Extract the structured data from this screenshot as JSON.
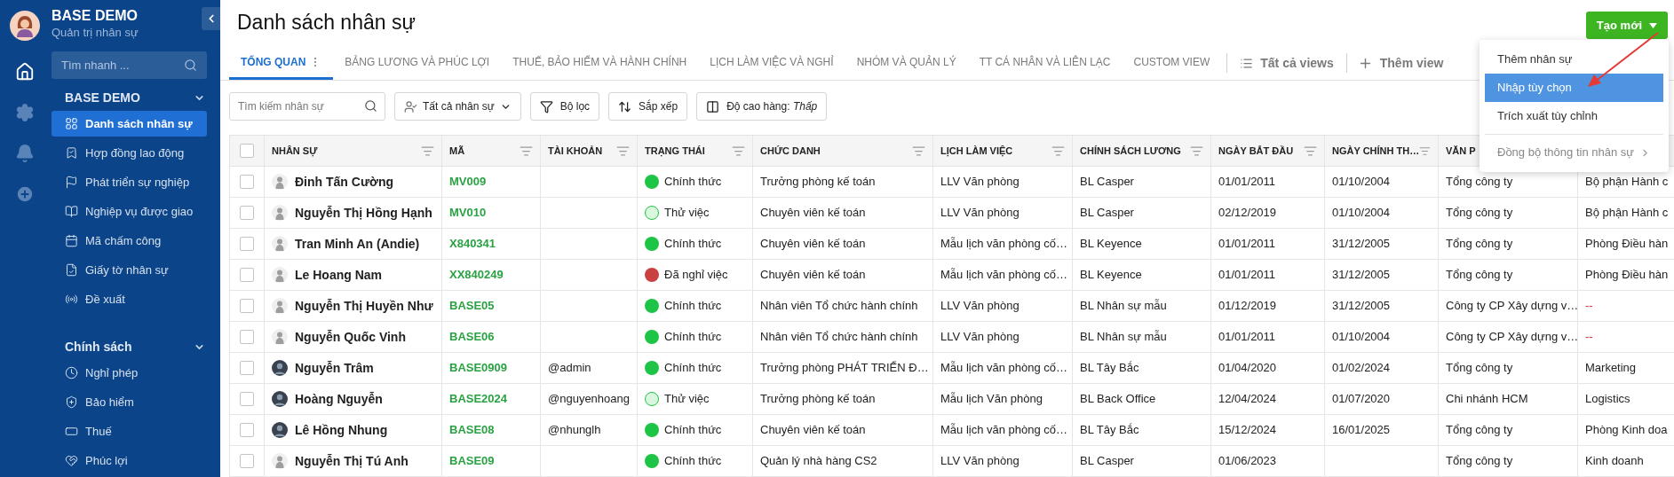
{
  "sidebar": {
    "app_title": "BASE DEMO",
    "app_subtitle": "Quản trị nhân sự",
    "search": {
      "placeholder": "Tìm nhanh ..."
    },
    "groups": [
      {
        "title": "BASE DEMO",
        "expanded": true,
        "items": [
          {
            "label": "Danh sách nhân sự",
            "selected": true
          },
          {
            "label": "Hợp đồng lao động",
            "selected": false
          },
          {
            "label": "Phát triển sự nghiệp",
            "selected": false
          },
          {
            "label": "Nghiệp vụ được giao",
            "selected": false
          },
          {
            "label": "Mã chấm công",
            "selected": false
          },
          {
            "label": "Giấy tờ nhân sự",
            "selected": false
          },
          {
            "label": "Đề xuất",
            "selected": false
          }
        ]
      },
      {
        "title": "Chính sách",
        "expanded": true,
        "items": [
          {
            "label": "Nghỉ phép",
            "selected": false
          },
          {
            "label": "Bảo hiểm",
            "selected": false
          },
          {
            "label": "Thuế",
            "selected": false
          },
          {
            "label": "Phúc lợi",
            "selected": false
          }
        ]
      }
    ]
  },
  "page_title": "Danh sách nhân sự",
  "create_button": "Tạo mới",
  "create_menu": [
    {
      "label": "Thêm nhân sự",
      "selected": false,
      "kind": "item"
    },
    {
      "label": "Nhập tùy chọn",
      "selected": true,
      "kind": "item"
    },
    {
      "label": "Trích xuất tùy chỉnh",
      "selected": false,
      "kind": "item"
    },
    {
      "label": "Đồng bộ thông tin nhân sự",
      "selected": false,
      "kind": "submenu"
    }
  ],
  "tabs": [
    {
      "label": "TỔNG QUAN",
      "selected": true
    },
    {
      "label": "BẢNG LƯƠNG VÀ PHÚC LỢI",
      "selected": false
    },
    {
      "label": "THUẾ, BẢO HIỂM VÀ HÀNH CHÍNH",
      "selected": false
    },
    {
      "label": "LỊCH LÀM VIỆC VÀ NGHỈ",
      "selected": false
    },
    {
      "label": "NHÓM VÀ QUẢN LÝ",
      "selected": false
    },
    {
      "label": "TT CÁ NHÂN VÀ LIÊN LẠC",
      "selected": false
    },
    {
      "label": "CUSTOM VIEW",
      "selected": false
    }
  ],
  "view_actions": [
    "Tất cả views",
    "Thêm view"
  ],
  "toolbar": {
    "search": {
      "placeholder": "Tìm kiếm nhân sự"
    },
    "audience": "Tất cả nhân sự",
    "filter": "Bộ lọc",
    "sort": "Sắp xếp",
    "row_height": "Độ cao hàng: *Thấp*"
  },
  "table": {
    "all_checked": false,
    "columns": [
      {
        "label": "NHÂN SỰ",
        "filter_icon": true
      },
      {
        "label": "MÃ",
        "filter_icon": true
      },
      {
        "label": "TÀI KHOẢN",
        "filter_icon": true
      },
      {
        "label": "TRẠNG THÁI",
        "filter_icon": true
      },
      {
        "label": "CHỨC DANH",
        "filter_icon": true
      },
      {
        "label": "LỊCH LÀM VIỆC",
        "filter_icon": true
      },
      {
        "label": "CHÍNH SÁCH LƯƠNG",
        "filter_icon": true
      },
      {
        "label": "NGÀY BẮT ĐẦU",
        "filter_icon": true
      },
      {
        "label": "NGÀY CHÍNH TH…",
        "filter_icon": true
      },
      {
        "label": "VĂN P",
        "filter_icon": false
      }
    ],
    "rows": [
      {
        "checked": false,
        "avatar": {
          "kind": "default"
        },
        "name": "Đinh Tấn Cường",
        "code": "MV009",
        "status": {
          "label": "Chính thức",
          "kind": "filled",
          "color": "#1ec445"
        },
        "title": "Trưởng phòng kế toán",
        "schedule": "LLV Văn phòng",
        "salary_policy": "BL Casper",
        "start_date": "01/01/2011",
        "official_date": "01/10/2004",
        "office": "Tổng công ty",
        "column_11": {
          "text": "Bộ phận Hành c",
          "kind": "value"
        }
      },
      {
        "checked": false,
        "avatar": {
          "kind": "default"
        },
        "name": "Nguyễn Thị Hồng Hạnh",
        "code": "MV010",
        "status": {
          "label": "Thử việc",
          "kind": "outline",
          "color": "#1ec445"
        },
        "title": "Chuyên viên kế toán",
        "schedule": "LLV Văn phòng",
        "salary_policy": "BL Casper",
        "start_date": "02/12/2019",
        "official_date": "01/10/2004",
        "office": "Tổng công ty",
        "column_11": {
          "text": "Bộ phận Hành c",
          "kind": "value"
        }
      },
      {
        "checked": false,
        "avatar": {
          "kind": "default"
        },
        "name": "Tran Minh An (Andie)",
        "code": "X840341",
        "status": {
          "label": "Chính thức",
          "kind": "filled",
          "color": "#1ec445"
        },
        "title": "Chuyên viên kế toán",
        "schedule": "Mẫu lịch văn phòng cố…",
        "salary_policy": "BL Keyence",
        "start_date": "01/01/2011",
        "official_date": "31/12/2005",
        "office": "Tổng công ty",
        "column_11": {
          "text": "Phòng Điều hàn",
          "kind": "value"
        }
      },
      {
        "checked": false,
        "avatar": {
          "kind": "default"
        },
        "name": "Le Hoang Nam",
        "code": "XX840249",
        "status": {
          "label": "Đã nghỉ việc",
          "kind": "filled",
          "color": "#c94141"
        },
        "title": "Chuyên viên kế toán",
        "schedule": "Mẫu lịch văn phòng cố…",
        "salary_policy": "BL Keyence",
        "start_date": "01/01/2011",
        "official_date": "31/12/2005",
        "office": "Tổng công ty",
        "column_11": {
          "text": "Phòng Điều hàn",
          "kind": "value"
        }
      },
      {
        "checked": false,
        "avatar": {
          "kind": "default"
        },
        "name": "Nguyễn Thị Huyền Như",
        "code": "BASE05",
        "status": {
          "label": "Chính thức",
          "kind": "filled",
          "color": "#1ec445"
        },
        "title": "Nhân viên Tổ chức hành chính",
        "schedule": "LLV Văn phòng",
        "salary_policy": "BL Nhân sự mẫu",
        "start_date": "01/12/2019",
        "official_date": "31/12/2005",
        "office": "Công ty CP Xây dựng v…",
        "column_11": {
          "text": "--",
          "kind": "empty"
        }
      },
      {
        "checked": false,
        "avatar": {
          "kind": "default"
        },
        "name": "Nguyễn Quốc Vinh",
        "code": "BASE06",
        "status": {
          "label": "Chính thức",
          "kind": "filled",
          "color": "#1ec445"
        },
        "title": "Nhân viên Tổ chức hành chính",
        "schedule": "LLV Văn phòng",
        "salary_policy": "BL Nhân sự mẫu",
        "start_date": "01/01/2011",
        "official_date": "01/10/2004",
        "office": "Công ty CP Xây dựng v…",
        "column_11": {
          "text": "--",
          "kind": "empty"
        }
      },
      {
        "checked": false,
        "avatar": {
          "kind": "photo"
        },
        "name": "Nguyễn Trâm",
        "code": "BASE0909",
        "account": "@admin",
        "status": {
          "label": "Chính thức",
          "kind": "filled",
          "color": "#1ec445"
        },
        "title": "Trưởng phòng PHÁT TRIỂN Đ…",
        "schedule": "Mẫu lịch văn phòng cố…",
        "salary_policy": "BL Tây Bắc",
        "start_date": "01/04/2020",
        "official_date": "01/02/2024",
        "office": "Tổng công ty",
        "column_11": {
          "text": "Marketing",
          "kind": "value"
        }
      },
      {
        "checked": false,
        "avatar": {
          "kind": "photo"
        },
        "name": "Hoàng Nguyễn",
        "code": "BASE2024",
        "account": "@nguyenhoang",
        "status": {
          "label": "Thử việc",
          "kind": "outline",
          "color": "#1ec445"
        },
        "title": "Trưởng phòng kế toán",
        "schedule": "Mẫu lịch Văn phòng",
        "salary_policy": "BL Back Office",
        "start_date": "12/04/2024",
        "official_date": "01/07/2020",
        "office": "Chi nhánh HCM",
        "column_11": {
          "text": "Logistics",
          "kind": "value"
        }
      },
      {
        "checked": false,
        "avatar": {
          "kind": "photo"
        },
        "name": "Lê Hồng Nhung",
        "code": "BASE08",
        "account": "@nhunglh",
        "status": {
          "label": "Chính thức",
          "kind": "filled",
          "color": "#1ec445"
        },
        "title": "Chuyên viên kế toán",
        "schedule": "Mẫu lịch văn phòng cố…",
        "salary_policy": "BL Tây Bắc",
        "start_date": "15/12/2024",
        "official_date": "16/01/2025",
        "office": "Tổng công ty",
        "column_11": {
          "text": "Phòng Kinh doa",
          "kind": "value"
        }
      },
      {
        "checked": false,
        "avatar": {
          "kind": "default"
        },
        "name": "Nguyễn Thị Tú Anh",
        "code": "BASE09",
        "status": {
          "label": "Chính thức",
          "kind": "filled",
          "color": "#1ec445"
        },
        "title": "Quản lý nhà hàng CS2",
        "schedule": "LLV Văn phòng",
        "salary_policy": "BL Casper",
        "start_date": "01/06/2023",
        "office": "Tổng công ty",
        "column_11": {
          "text": "Kinh doanh",
          "kind": "value"
        }
      }
    ]
  }
}
